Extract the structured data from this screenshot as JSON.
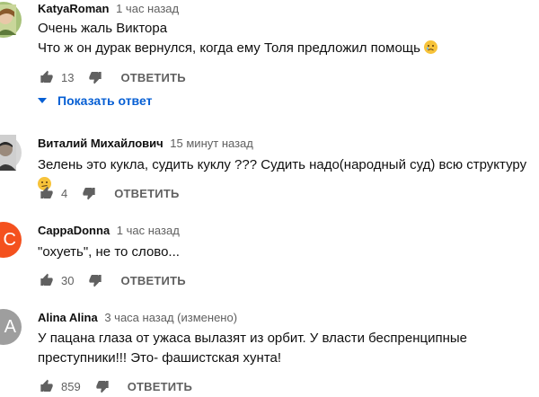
{
  "comments": [
    {
      "author": "KatyaRoman",
      "time": "1 час назад",
      "lines": [
        "Очень жаль Виктора",
        "Что ж он дурак вернулся, когда ему Толя предложил помощь"
      ],
      "emoji": "sad-face",
      "likes": "13",
      "reply_label": "ОТВЕТИТЬ",
      "show_replies_label": "Показать ответ",
      "avatar_color": "#a8c27a"
    },
    {
      "author": "Виталий Михайлович",
      "time": "15 минут назад",
      "lines": [
        "Зелень это кукла, судить куклу ??? Судить надо(народный суд) всю структуру"
      ],
      "emoji": "confused-face",
      "likes": "4",
      "reply_label": "ОТВЕТИТЬ",
      "avatar_color": "#555555"
    },
    {
      "author": "CappaDonna",
      "time": "1 час назад",
      "lines": [
        "\"охуеть\", не то слово..."
      ],
      "likes": "30",
      "reply_label": "ОТВЕТИТЬ",
      "avatar_letter": "C",
      "avatar_color": "#f4511e"
    },
    {
      "author": "Alina Alina",
      "time": "3 часа назад (изменено)",
      "lines": [
        "У пацана глаза от ужаса вылазят из орбит. У власти беспренципные",
        "преступники!!! Это- фашистская хунта!"
      ],
      "likes": "859",
      "reply_label": "ОТВЕТИТЬ",
      "avatar_letter": "A",
      "avatar_color": "#9e9e9e"
    }
  ],
  "colors": {
    "link": "#065fd4",
    "secondary": "#606060",
    "text": "#0f0f0f"
  }
}
